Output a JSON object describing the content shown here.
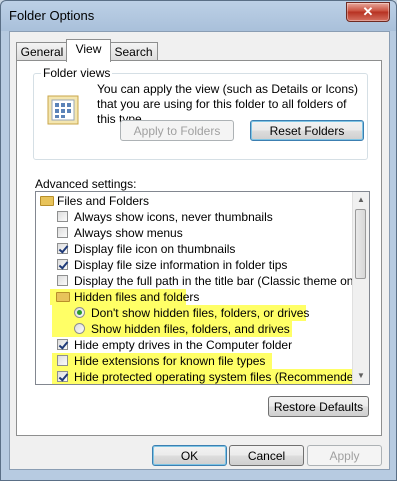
{
  "window": {
    "title": "Folder Options",
    "close_label": "✕"
  },
  "tabs": [
    {
      "label": "General"
    },
    {
      "label": "View"
    },
    {
      "label": "Search"
    }
  ],
  "folder_views": {
    "label": "Folder views",
    "description": "You can apply the view (such as Details or Icons) that you are using for this folder to all folders of this type.",
    "apply_label": "Apply to Folders",
    "reset_label": "Reset Folders"
  },
  "advanced": {
    "label": "Advanced settings:",
    "items": [
      {
        "type": "folder",
        "label": "Files and Folders"
      },
      {
        "type": "checkbox",
        "checked": false,
        "label": "Always show icons, never thumbnails"
      },
      {
        "type": "checkbox",
        "checked": false,
        "label": "Always show menus"
      },
      {
        "type": "checkbox",
        "checked": true,
        "label": "Display file icon on thumbnails"
      },
      {
        "type": "checkbox",
        "checked": true,
        "label": "Display file size information in folder tips"
      },
      {
        "type": "checkbox",
        "checked": false,
        "label": "Display the full path in the title bar (Classic theme only)"
      },
      {
        "type": "folder",
        "label": "Hidden files and folders",
        "highlight": true
      },
      {
        "type": "radio",
        "checked": true,
        "label": "Don't show hidden files, folders, or drives",
        "highlight": true
      },
      {
        "type": "radio",
        "checked": false,
        "label": "Show hidden files, folders, and drives",
        "highlight": true
      },
      {
        "type": "checkbox",
        "checked": true,
        "label": "Hide empty drives in the Computer folder"
      },
      {
        "type": "checkbox",
        "checked": false,
        "label": "Hide extensions for known file types",
        "highlight": true
      },
      {
        "type": "checkbox",
        "checked": true,
        "label": "Hide protected operating system files (Recommended)",
        "highlight": true
      }
    ]
  },
  "restore_label": "Restore Defaults",
  "footer": {
    "ok_label": "OK",
    "cancel_label": "Cancel",
    "apply_label": "Apply"
  },
  "colors": {
    "highlight": "#ffff33"
  }
}
